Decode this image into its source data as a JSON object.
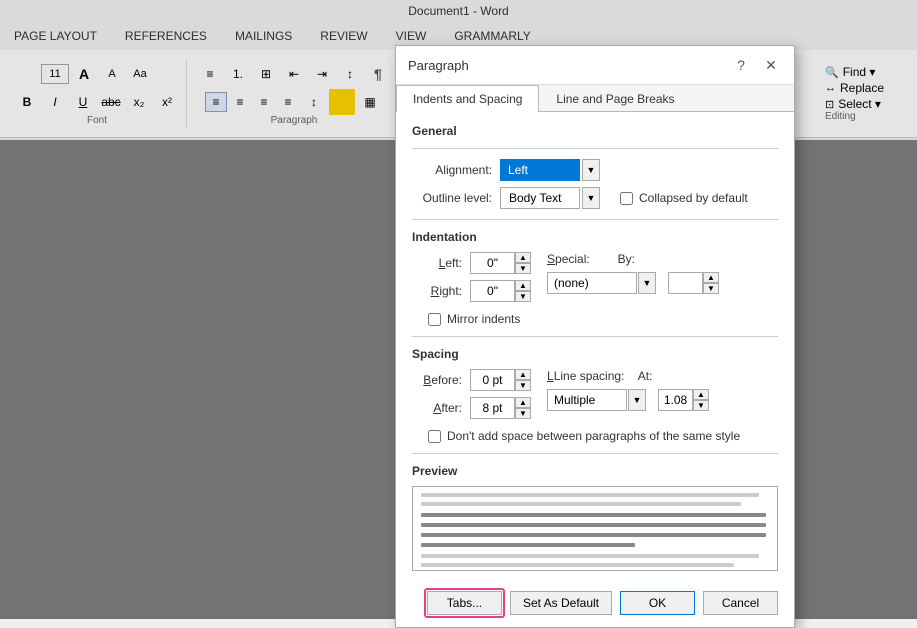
{
  "title_bar": {
    "text": "Document1 - Word"
  },
  "menu_bar": {
    "items": [
      "PAGE LAYOUT",
      "REFERENCES",
      "MAILINGS",
      "REVIEW",
      "VIEW",
      "GRAMMARLY"
    ]
  },
  "ribbon": {
    "font_group_label": "Font",
    "paragraph_group_label": "Paragraph",
    "editing_group_label": "Editing",
    "font_size": "11",
    "editing_items": [
      "Find ▾",
      "Replace",
      "Select ▾"
    ]
  },
  "dialog": {
    "title": "Paragraph",
    "help_btn": "?",
    "close_btn": "✕",
    "tabs": [
      {
        "label": "Indents and Spacing",
        "active": true
      },
      {
        "label": "Line and Page Breaks",
        "active": false
      }
    ],
    "general_section": {
      "label": "General",
      "alignment_label": "Alignment:",
      "alignment_value": "Left",
      "outline_label": "Outline level:",
      "outline_value": "Body Text",
      "collapsed_checkbox_label": "Collapsed by default"
    },
    "indentation_section": {
      "label": "Indentation",
      "left_label": "Left:",
      "left_value": "0\"",
      "right_label": "Right:",
      "right_value": "0\"",
      "mirror_label": "Mirror indents",
      "special_label": "Special:",
      "special_value": "(none)",
      "by_label": "By:",
      "by_value": ""
    },
    "spacing_section": {
      "label": "Spacing",
      "before_label": "Before:",
      "before_value": "0 pt",
      "after_label": "After:",
      "after_value": "8 pt",
      "line_spacing_label": "Line spacing:",
      "line_spacing_value": "Multiple",
      "at_label": "At:",
      "at_value": "1.08",
      "dont_add_label": "Don't add space between paragraphs of the same style"
    },
    "preview_section": {
      "label": "Preview"
    },
    "footer": {
      "tabs_btn": "Tabs...",
      "set_default_btn": "Set As Default",
      "ok_btn": "OK",
      "cancel_btn": "Cancel"
    }
  }
}
